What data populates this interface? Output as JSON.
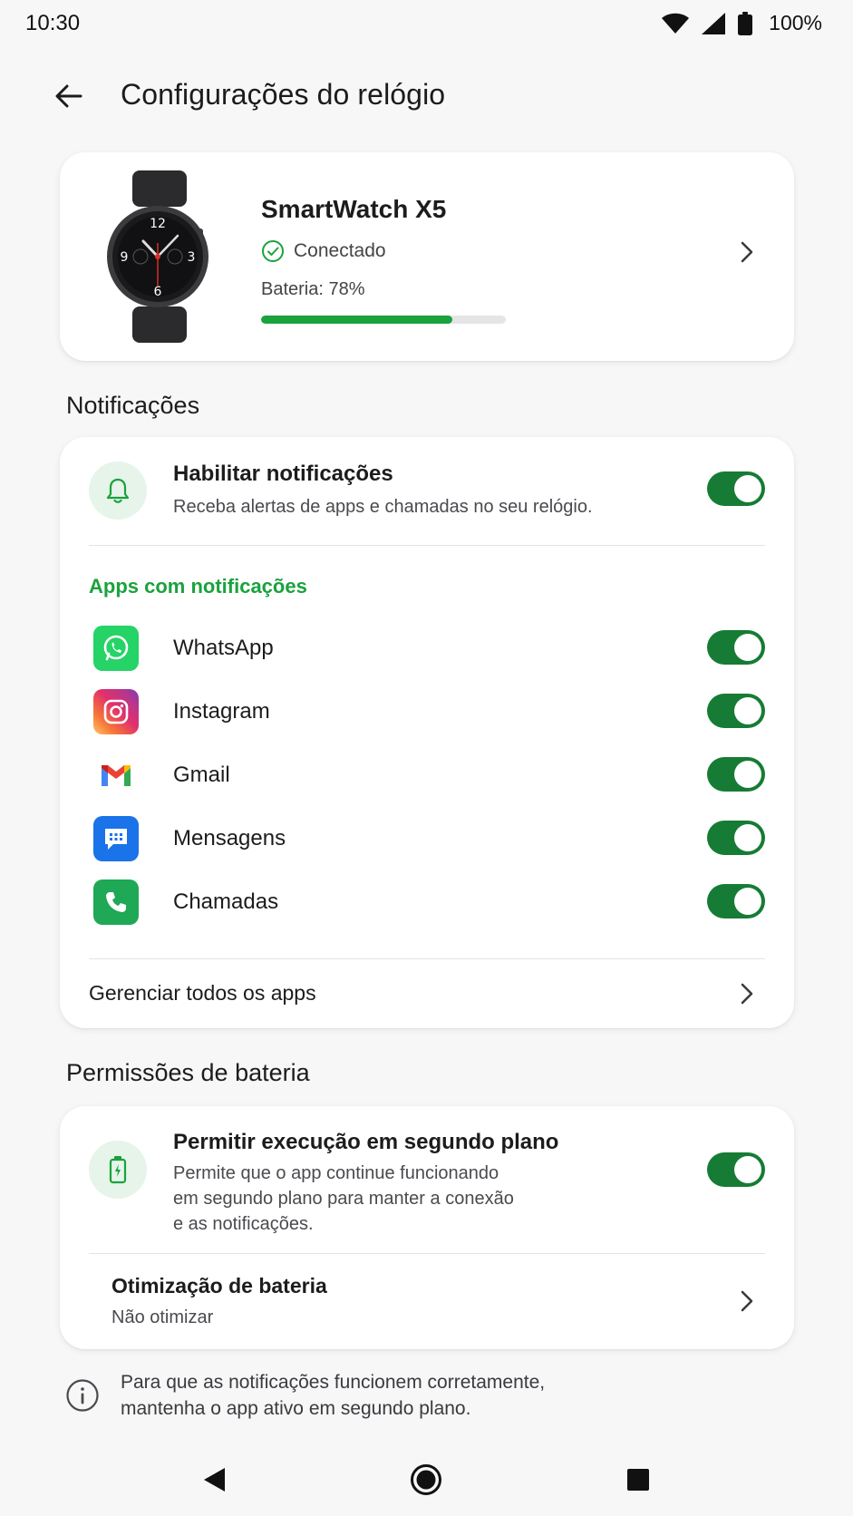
{
  "status_bar": {
    "time": "10:30",
    "battery": "100%",
    "icons": [
      "wifi-icon",
      "signal-icon",
      "battery-icon"
    ]
  },
  "header": {
    "title": "Configurações do relógio",
    "back_icon": "arrow-left-icon"
  },
  "device": {
    "name": "SmartWatch X5",
    "status": "Conectado",
    "battery_label": "Bateria: 78%",
    "battery_level": 0.78,
    "accent": "#1aa23d"
  },
  "notifications": {
    "section_title": "Notificações",
    "enable": {
      "title": "Habilitar notificações",
      "subtitle": "Receba alertas de apps e chamadas no seu relógio.",
      "enabled": true
    },
    "apps_title": "Apps com notificações",
    "apps": [
      {
        "name": "WhatsApp",
        "icon": "whatsapp-icon",
        "enabled": true
      },
      {
        "name": "Instagram",
        "icon": "instagram-icon",
        "enabled": true
      },
      {
        "name": "Gmail",
        "icon": "gmail-icon",
        "enabled": true
      },
      {
        "name": "Mensagens",
        "icon": "messages-icon",
        "enabled": true
      },
      {
        "name": "Chamadas",
        "icon": "phone-icon",
        "enabled": true
      }
    ],
    "manage_label": "Gerenciar todos os apps"
  },
  "battery_permissions": {
    "section_title": "Permissões de bateria",
    "background": {
      "title": "Permitir execução em segundo plano",
      "subtitle_lines": [
        "Permite que o app continue funcionando",
        "em segundo plano para manter a conexão",
        "e as notificações."
      ],
      "enabled": true
    },
    "optimization": {
      "title": "Otimização de bateria",
      "value": "Não otimizar"
    }
  },
  "info": {
    "lines": [
      "Para que as notificações funcionem corretamente,",
      "mantenha o app ativo em segundo plano."
    ]
  },
  "toggle_color": "#167c35"
}
